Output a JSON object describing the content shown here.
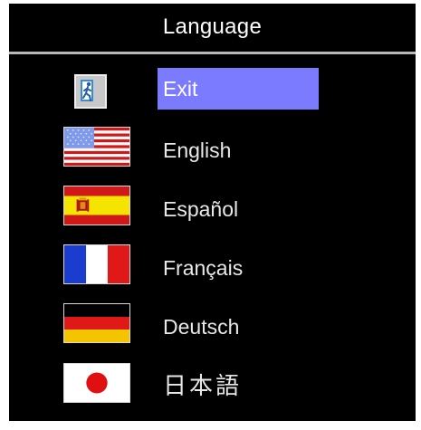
{
  "menu": {
    "title": "Language",
    "items": [
      {
        "label": "Exit",
        "icon": "exit-icon",
        "selected": true
      },
      {
        "label": "English",
        "icon": "us-flag-icon",
        "selected": false
      },
      {
        "label": "Español",
        "icon": "spain-flag-icon",
        "selected": false
      },
      {
        "label": "Français",
        "icon": "france-flag-icon",
        "selected": false
      },
      {
        "label": "Deutsch",
        "icon": "germany-flag-icon",
        "selected": false
      },
      {
        "label": "日本語",
        "icon": "japan-flag-icon",
        "selected": false
      }
    ]
  },
  "colors": {
    "background": "#000000",
    "highlight": "#7b7bff",
    "text": "#e8e8e8"
  }
}
